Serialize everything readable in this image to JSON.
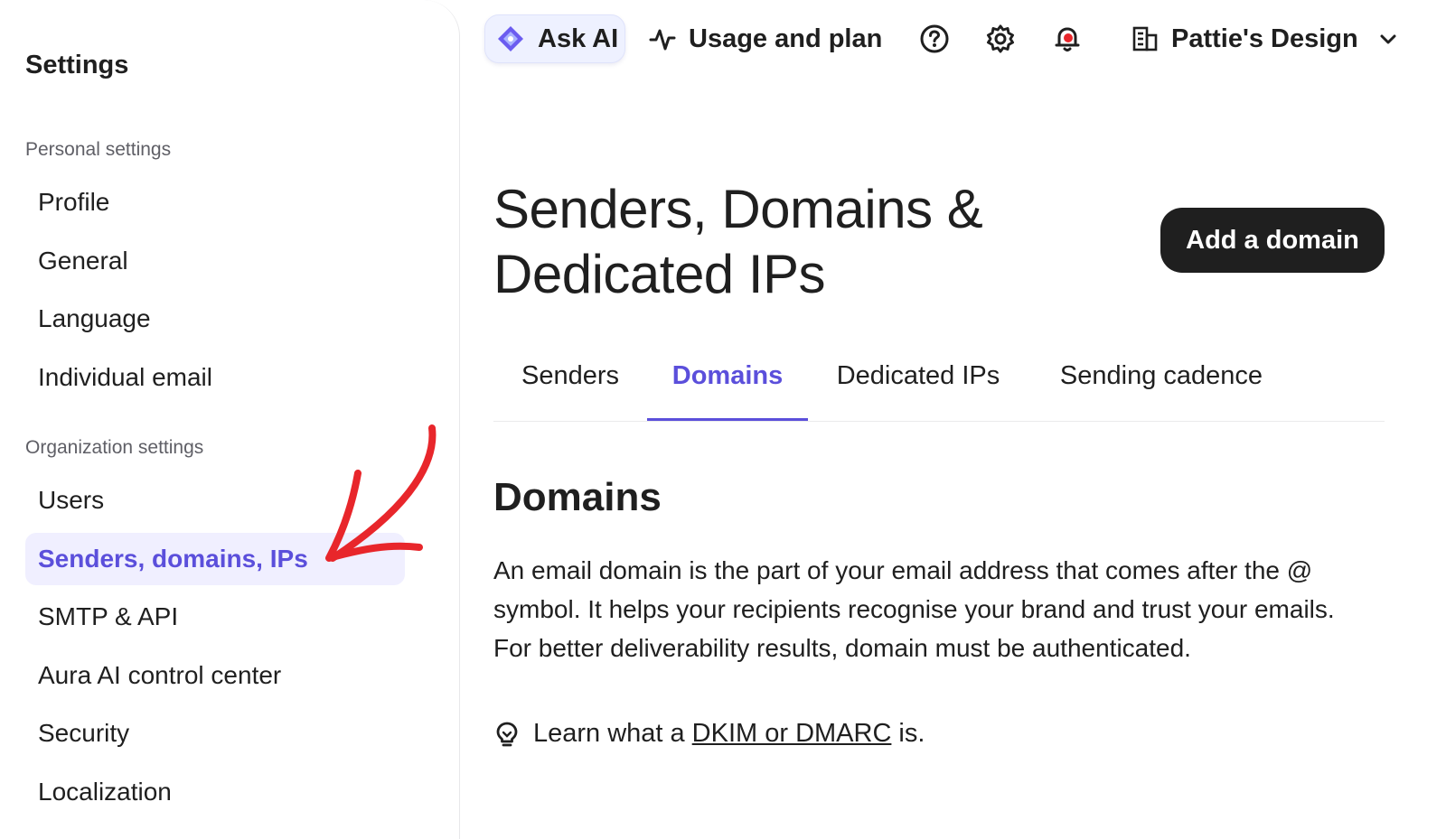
{
  "sidebar": {
    "title": "Settings",
    "personal_label": "Personal settings",
    "personal_items": [
      "Profile",
      "General",
      "Language",
      "Individual email"
    ],
    "org_label": "Organization settings",
    "org_items": [
      "Users",
      "Senders, domains, IPs",
      "SMTP & API",
      "Aura AI control center",
      "Security",
      "Localization"
    ],
    "active_item": "Senders, domains, IPs"
  },
  "topbar": {
    "ask_ai": "Ask AI",
    "usage": "Usage and plan",
    "org_name": "Pattie's Design",
    "icons": [
      "sparkle-icon",
      "pulse-icon",
      "help-icon",
      "gear-icon",
      "bell-icon",
      "building-icon",
      "chevron-down-icon"
    ]
  },
  "main": {
    "title": "Senders, Domains & Dedicated IPs",
    "add_button": "Add a domain",
    "tabs": [
      "Senders",
      "Domains",
      "Dedicated IPs",
      "Sending cadence"
    ],
    "active_tab": "Domains",
    "section_title": "Domains",
    "description": "An email domain is the part of your email address that comes after the @ symbol. It helps your recipients recognise your brand and trust your emails. For better deliverability results, domain must be authenticated.",
    "learn_prefix": "Learn what a",
    "learn_link": "DKIM or DMARC",
    "learn_suffix": "is."
  },
  "colors": {
    "accent": "#5b4fdb",
    "active_bg": "#f0efff",
    "annotation": "#e8262b",
    "button_bg": "#1f1f1f"
  }
}
